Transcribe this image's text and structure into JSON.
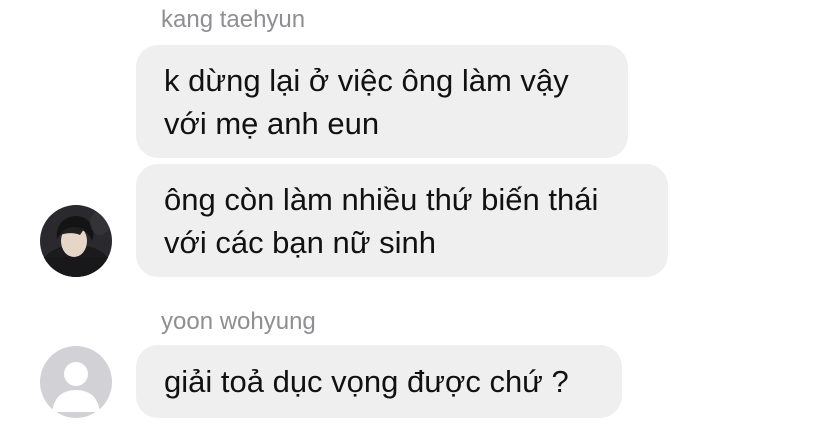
{
  "messages": [
    {
      "sender": "kang taehyun",
      "bubbles": [
        {
          "lines": [
            "k dừng lại ở việc ông làm vậy",
            "với mẹ anh eun"
          ]
        },
        {
          "lines": [
            "ông còn làm nhiều thứ biến thái",
            "với các bạn nữ sinh"
          ]
        }
      ],
      "avatar_icon": "profile-photo"
    },
    {
      "sender": "yoon wohyung",
      "bubbles": [
        {
          "lines": [
            "giải toả dục vọng được chứ ?"
          ]
        }
      ],
      "avatar_icon": "default-user-icon"
    }
  ],
  "colors": {
    "bubble": "#efefef",
    "sender_name": "#8e8e93",
    "text": "#111111",
    "default_avatar_bg": "#d1d1d6"
  }
}
